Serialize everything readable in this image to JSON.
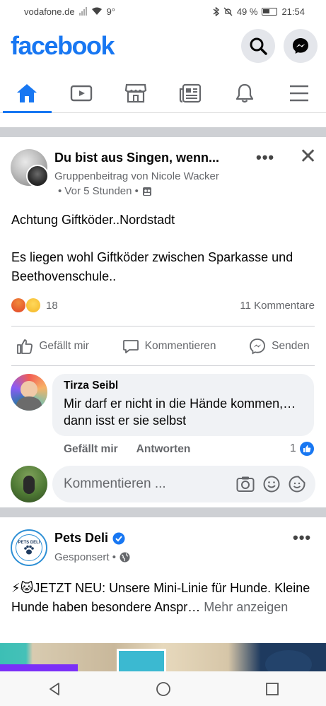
{
  "status_bar": {
    "carrier": "vodafone.de",
    "temperature": "9°",
    "battery": "49 %",
    "time": "21:54"
  },
  "header": {
    "logo": "facebook"
  },
  "tabs": [
    {
      "icon": "home-icon",
      "active": true
    },
    {
      "icon": "video-icon",
      "active": false
    },
    {
      "icon": "marketplace-icon",
      "active": false
    },
    {
      "icon": "news-icon",
      "active": false
    },
    {
      "icon": "bell-icon",
      "active": false
    },
    {
      "icon": "menu-icon",
      "active": false
    }
  ],
  "post1": {
    "title": "Du bist aus Singen, wenn...",
    "subtitle": "Gruppenbeitrag von Nicole Wacker",
    "meta": "• Vor 5 Stunden •",
    "body_line1": "Achtung Giftköder..Nordstadt",
    "body_line2": "Es liegen wohl Giftköder zwischen Sparkasse und Beethovenschule..",
    "reactions_count": "18",
    "comments_count": "11 Kommentare",
    "actions": {
      "like": "Gefällt mir",
      "comment": "Kommentieren",
      "share": "Senden"
    },
    "comment": {
      "author": "Tirza Seibl",
      "text": "Mir darf er nicht in die Hände kommen,… dann isst er sie selbst",
      "like_label": "Gefällt mir",
      "reply_label": "Antworten",
      "likes": "1"
    },
    "comment_input": {
      "placeholder": "Kommentieren ..."
    }
  },
  "post2": {
    "title": "Pets Deli",
    "subtitle": "Gesponsert •",
    "body": "⚡🐱JETZT NEU: Unsere Mini-Linie für Hunde. Kleine Hunde haben besondere Anspr…",
    "more_label": "Mehr anzeigen",
    "logo_text": "PETS DELI"
  },
  "colors": {
    "accent": "#1877f2",
    "secondary_text": "#65676b",
    "bubble": "#f0f2f5"
  }
}
